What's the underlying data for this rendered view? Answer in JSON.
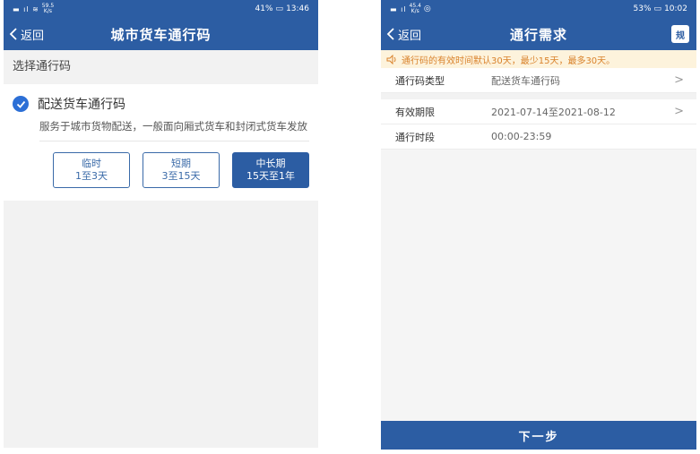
{
  "phone1": {
    "status": {
      "network": "59.5\nK/s",
      "battery": "41%",
      "time": "13:46"
    },
    "nav": {
      "back_label": "返回",
      "title": "城市货车通行码"
    },
    "section_title": "选择通行码",
    "option": {
      "label": "配送货车通行码",
      "description": "服务于城市货物配送，一般面向厢式货车和封闭式货车发放",
      "checked": true
    },
    "periods": [
      {
        "name": "临时",
        "range": "1至3天",
        "selected": false
      },
      {
        "name": "短期",
        "range": "3至15天",
        "selected": false
      },
      {
        "name": "中长期",
        "range": "15天至1年",
        "selected": true
      }
    ]
  },
  "phone2": {
    "status": {
      "network": "45.4\nK/s",
      "battery": "53%",
      "time": "10:02"
    },
    "nav": {
      "back_label": "返回",
      "title": "通行需求",
      "rules_icon_label": "规"
    },
    "notice": "通行码的有效时间默认30天，最少15天，最多30天。",
    "rows": [
      {
        "key": "通行码类型",
        "value": "配送货车通行码",
        "arrow": ">"
      },
      {
        "key": "有效期限",
        "value": "2021-07-14至2021-08-12",
        "arrow": ">"
      },
      {
        "key": "通行时段",
        "value": "00:00-23:59"
      }
    ],
    "next_button": "下一步"
  },
  "colors": {
    "primary": "#2c5da3",
    "check": "#2c6fd6",
    "notice_text": "#d9822b",
    "notice_bg": "#fdf3dc"
  }
}
